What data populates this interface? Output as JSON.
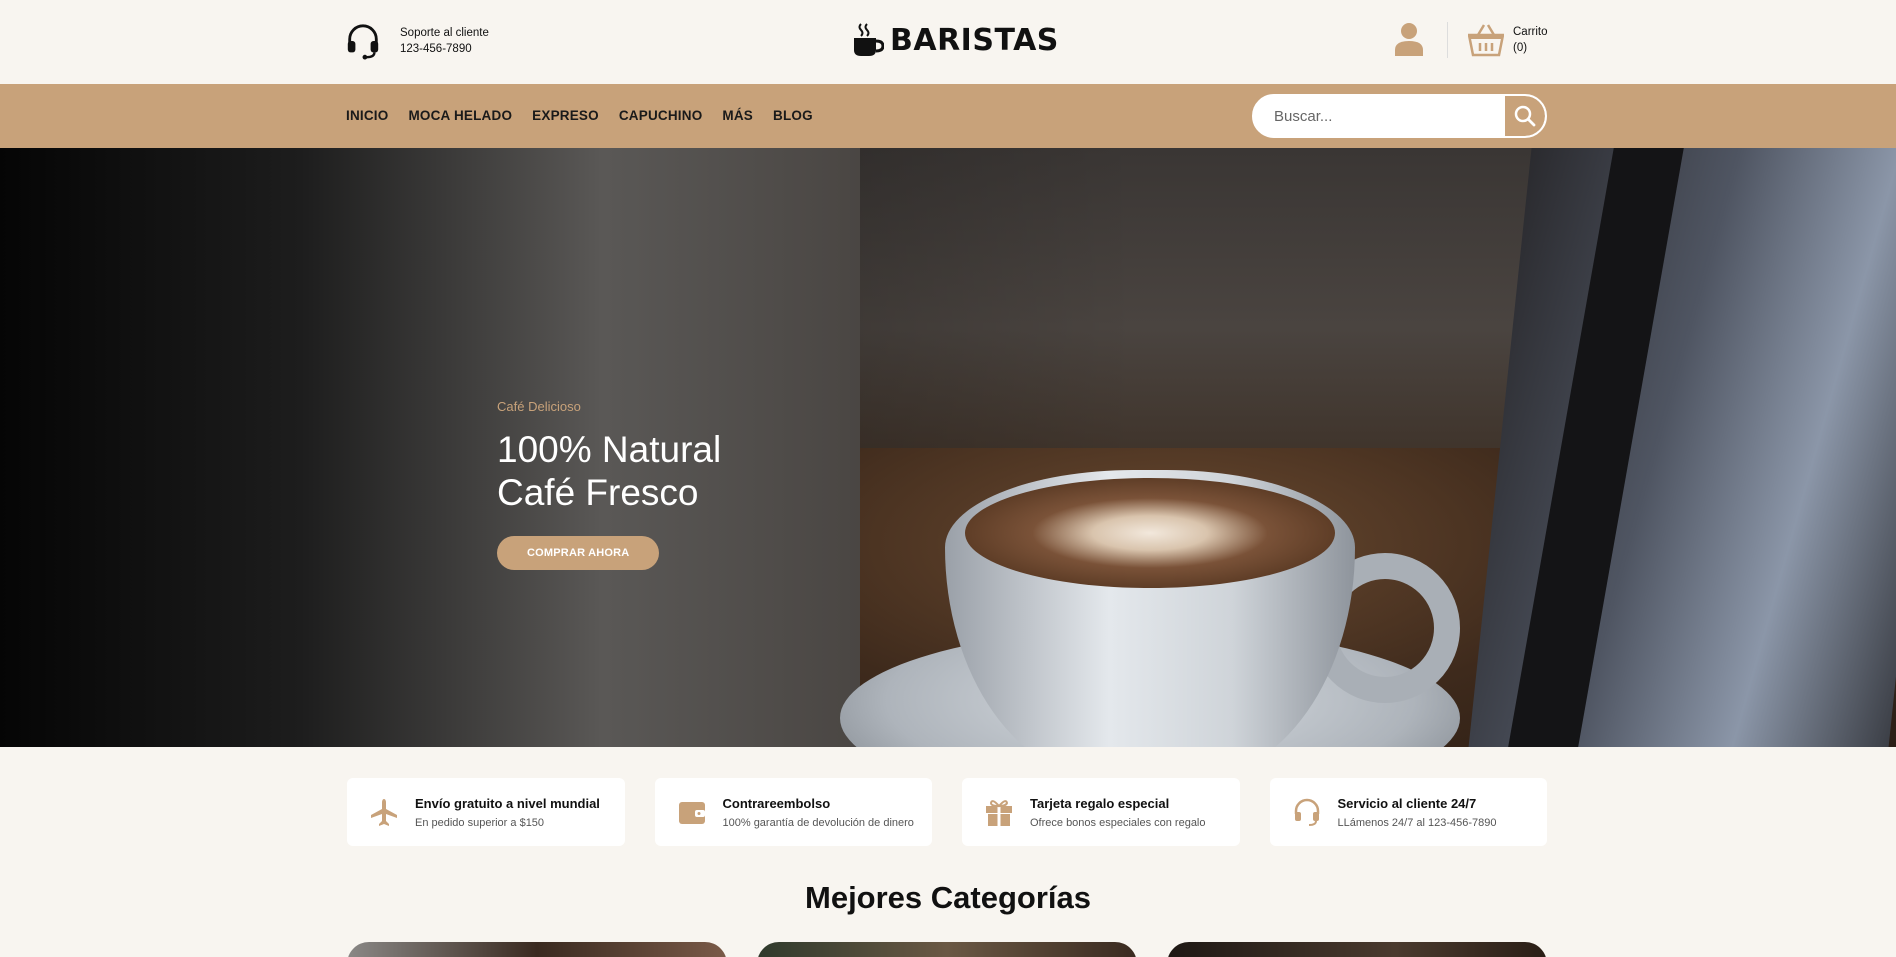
{
  "header": {
    "support_label": "Soporte al cliente",
    "support_phone": "123-456-7890",
    "brand": "BARISTAS",
    "cart_label": "Carrito",
    "cart_count": "(0)"
  },
  "nav": {
    "items": [
      "INICIO",
      "MOCA HELADO",
      "EXPRESO",
      "CAPUCHINO",
      "MÁS",
      "BLOG"
    ],
    "search_placeholder": "Buscar..."
  },
  "hero": {
    "kicker": "Café Delicioso",
    "title_line1": "100% Natural",
    "title_line2": "Café Fresco",
    "cta": "COMPRAR AHORA"
  },
  "features": [
    {
      "icon": "airplane-icon",
      "title": "Envío gratuito a nivel mundial",
      "desc": "En pedido superior a $150"
    },
    {
      "icon": "wallet-icon",
      "title": "Contrareembolso",
      "desc": "100% garantía de devolución de dinero"
    },
    {
      "icon": "gift-icon",
      "title": "Tarjeta regalo especial",
      "desc": "Ofrece bonos especiales con regalo"
    },
    {
      "icon": "headset-icon",
      "title": "Servicio al cliente 24/7",
      "desc": "LLámenos 24/7 al 123-456-7890"
    }
  ],
  "categories": {
    "title": "Mejores Categorías"
  },
  "colors": {
    "accent": "#c8a27a",
    "background": "#f8f5f0",
    "text": "#111111"
  }
}
